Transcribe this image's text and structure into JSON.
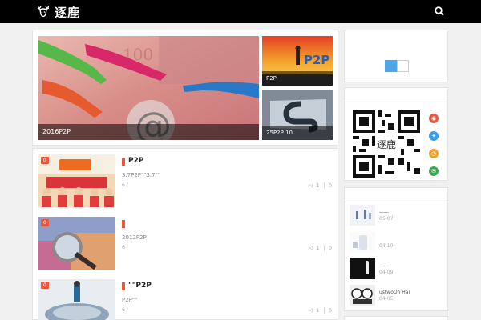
{
  "header": {
    "logo_text": "逐鹿",
    "search_icon": "search-icon"
  },
  "slider": {
    "main_caption": "2016P2P",
    "side1_caption": "P2P",
    "side1_overlay_text": "P2P",
    "side2_caption": "25P2P 10"
  },
  "posts": [
    {
      "tag": "0",
      "title": "P2P",
      "excerpt": "3.7P2P\"\"3.7\"\"",
      "meta": "6  /",
      "likes": "1",
      "comments": "0"
    },
    {
      "tag": "0",
      "title": "",
      "excerpt": "2012P2P",
      "meta": "6  /",
      "likes": "1",
      "comments": "0"
    },
    {
      "tag": "0",
      "title": "\"\"P2P",
      "excerpt": "P2P\"\"",
      "meta": "6  /",
      "likes": "1",
      "comments": "0"
    }
  ],
  "sidebar": {
    "qr_center_text": "逐鹿",
    "colors": {
      "blue": "#4da6e6",
      "weibo": "#e9573f",
      "twitter": "#3d9ee8",
      "rss": "#f0a030",
      "mail": "#3aa757"
    },
    "recent": [
      {
        "title": "——",
        "date": "05-07"
      },
      {
        "title": "",
        "date": "04-10"
      },
      {
        "title": "——",
        "date": "04-09"
      },
      {
        "title": "ustwoOh Hai",
        "date": "04-05"
      }
    ]
  }
}
